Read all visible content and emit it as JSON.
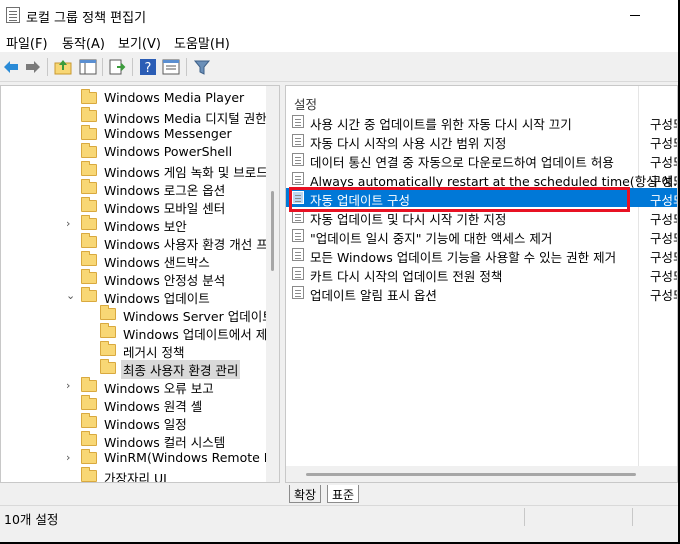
{
  "window": {
    "title": "로컬 그룹 정책 편집기"
  },
  "menu": [
    "파일(F)",
    "동작(A)",
    "보기(V)",
    "도움말(H)"
  ],
  "toolbar": {
    "buttons": [
      "back-icon",
      "forward-icon",
      "up-folder-icon",
      "show-hide-tree-icon",
      "export-list-icon",
      "help-icon",
      "properties-icon",
      "filter-icon"
    ]
  },
  "tree": {
    "items": [
      {
        "label": "Windows Media Player",
        "expander": ""
      },
      {
        "label": "Windows Media 디지털 권한 관",
        "expander": ""
      },
      {
        "label": "Windows Messenger",
        "expander": ""
      },
      {
        "label": "Windows PowerShell",
        "expander": ""
      },
      {
        "label": "Windows 게임 녹화 및 브로드",
        "expander": ""
      },
      {
        "label": "Windows 로그온 옵션",
        "expander": ""
      },
      {
        "label": "Windows 모바일 센터",
        "expander": ""
      },
      {
        "label": "Windows 보안",
        "expander": "›"
      },
      {
        "label": "Windows 사용자 환경 개선 프",
        "expander": ""
      },
      {
        "label": "Windows 샌드박스",
        "expander": ""
      },
      {
        "label": "Windows 안정성 분석",
        "expander": ""
      },
      {
        "label": "Windows 업데이트",
        "expander": "⌄"
      },
      {
        "label": "Windows Server 업데이트",
        "expander": ""
      },
      {
        "label": "Windows 업데이트에서 제",
        "expander": ""
      },
      {
        "label": "레거시 정책",
        "expander": ""
      },
      {
        "label": "최종 사용자 환경 관리",
        "expander": ""
      },
      {
        "label": "Windows 오류 보고",
        "expander": "›"
      },
      {
        "label": "Windows 원격 셸",
        "expander": ""
      },
      {
        "label": "Windows 일정",
        "expander": ""
      },
      {
        "label": "Windows 컬러 시스템",
        "expander": ""
      },
      {
        "label": "WinRM(Windows Remote Mar",
        "expander": "›"
      },
      {
        "label": "가장자리 UI",
        "expander": ""
      }
    ]
  },
  "details": {
    "column_setting": "설정",
    "rows": [
      {
        "name": "사용 시간 중 업데이트를 위한 자동 다시 시작 끄기",
        "state": "구성되"
      },
      {
        "name": "자동 다시 시작의 사용 시간 범위 지정",
        "state": "구성되"
      },
      {
        "name": "데이터 통신 연결 중 자동으로 다운로드하여 업데이트 허용",
        "state": "구성되"
      },
      {
        "name": "Always automatically restart at the scheduled time(항상 예...",
        "state": "구성되"
      },
      {
        "name": "자동 업데이트 구성",
        "state": "구성되"
      },
      {
        "name": "자동 업데이트 및 다시 시작 기한 지정",
        "state": "구성되"
      },
      {
        "name": "\"업데이트 일시 중지\" 기능에 대한 액세스 제거",
        "state": "구성되"
      },
      {
        "name": "모든 Windows 업데이트 기능을 사용할 수 있는 권한 제거",
        "state": "구성되"
      },
      {
        "name": "카트 다시 시작의 업데이트 전원 정책",
        "state": "구성되"
      },
      {
        "name": "업데이트 알림 표시 옵션",
        "state": "구성되"
      }
    ]
  },
  "tabs": [
    "확장",
    "표준"
  ],
  "status": {
    "text": "10개 설정"
  },
  "colors": {
    "selection": "#0078d7",
    "highlight_box": "#e81123"
  }
}
